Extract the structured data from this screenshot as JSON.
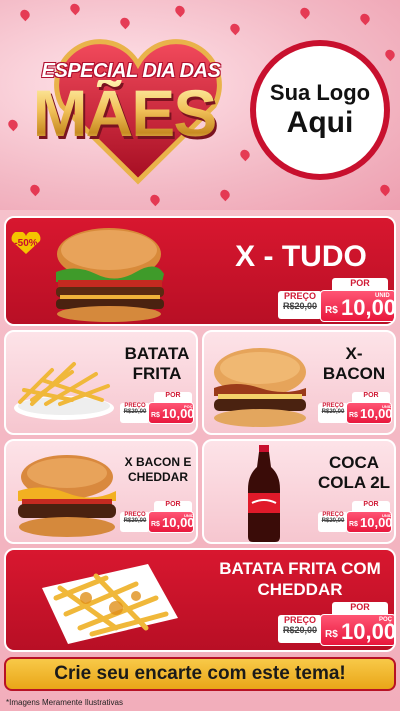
{
  "header": {
    "title_top": "ESPECIAL DIA DAS",
    "title_main": "MÃES",
    "logo_line1": "Sua Logo",
    "logo_line2": "Aqui"
  },
  "colors": {
    "red": "#c8102e",
    "pink": "#f6c6cf",
    "gold": "#f3c766"
  },
  "discount_badge": "-50%",
  "products": [
    {
      "name": "X - TUDO",
      "por": "POR",
      "preco_label": "PREÇO",
      "old_price": "R$20,00",
      "currency": "R$",
      "price": "10,00",
      "unit": "UNID",
      "icon": "burger-icon"
    },
    {
      "name_l1": "BATATA",
      "name_l2": "FRITA",
      "por": "POR",
      "preco_label": "PREÇO",
      "old_price": "R$20,00",
      "currency": "R$",
      "price": "10,00",
      "unit": "POÇ",
      "icon": "fries-icon"
    },
    {
      "name_l1": "X-",
      "name_l2": "BACON",
      "por": "POR",
      "preco_label": "PREÇO",
      "old_price": "R$20,00",
      "currency": "R$",
      "price": "10,00",
      "unit": "UNID",
      "icon": "burger-icon"
    },
    {
      "name_l1": "X BACON E",
      "name_l2": "CHEDDAR",
      "por": "POR",
      "preco_label": "PREÇO",
      "old_price": "R$20,00",
      "currency": "R$",
      "price": "10,00",
      "unit": "UNID",
      "icon": "burger-icon"
    },
    {
      "name_l1": "COCA",
      "name_l2": "COLA 2L",
      "por": "POR",
      "preco_label": "PREÇO",
      "old_price": "R$20,00",
      "currency": "R$",
      "price": "10,00",
      "unit": "UNID",
      "icon": "soda-bottle-icon"
    },
    {
      "name_l1": "BATATA FRITA COM",
      "name_l2": "CHEDDAR",
      "por": "POR",
      "preco_label": "PREÇO",
      "old_price": "R$20,00",
      "currency": "R$",
      "price": "10,00",
      "unit": "POÇ",
      "icon": "fries-icon"
    }
  ],
  "banner": "Crie seu encarte com este tema!",
  "footer": "*Imagens Meramente Ilustrativas"
}
